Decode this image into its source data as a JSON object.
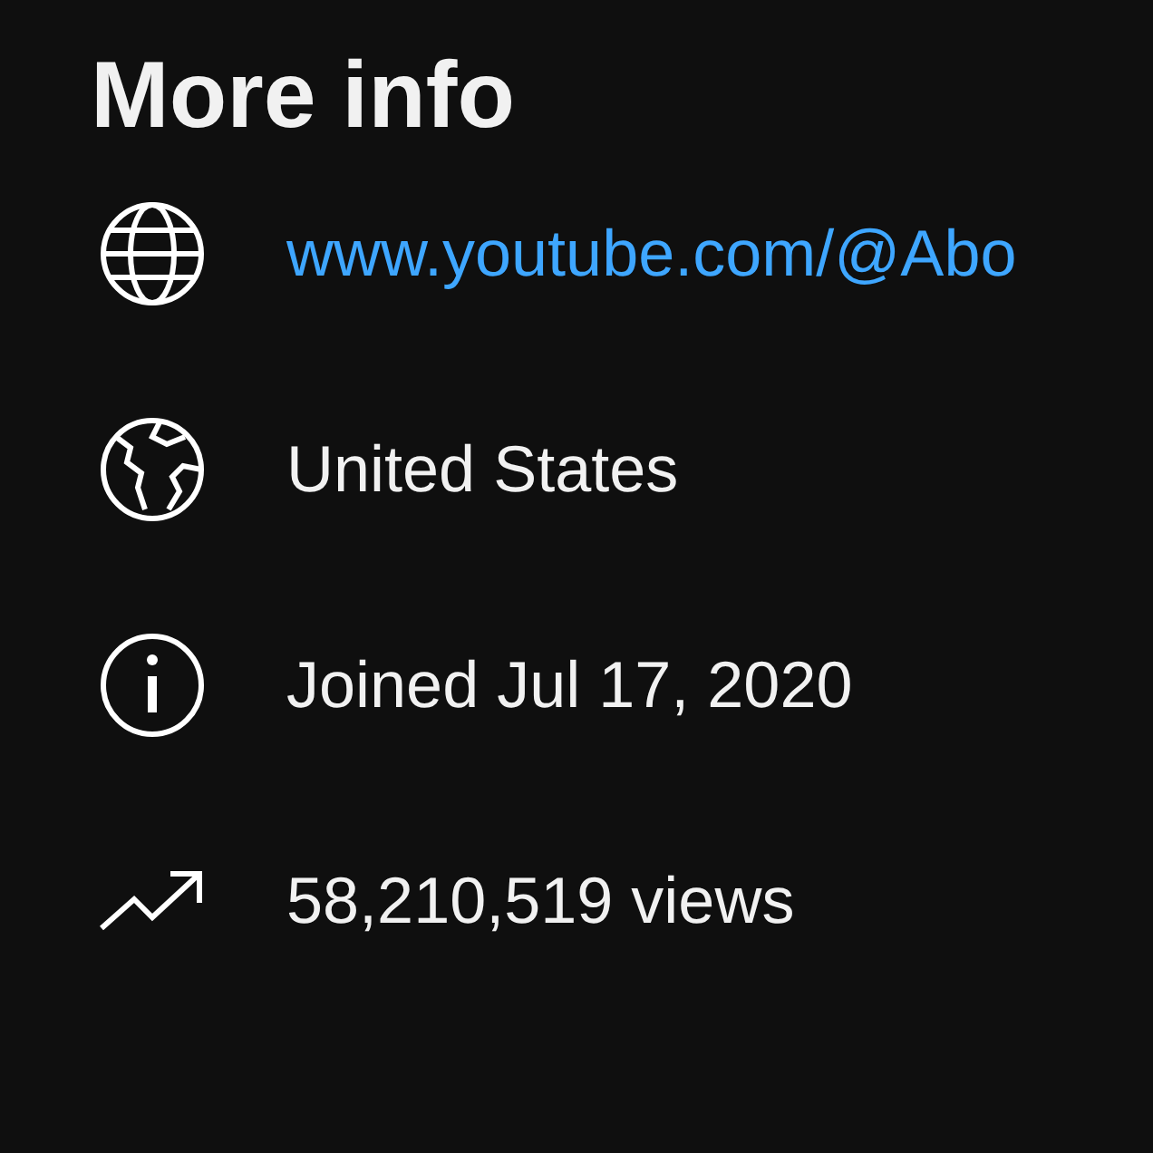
{
  "title": "More info",
  "items": [
    {
      "kind": "link",
      "text": "www.youtube.com/@Abo"
    },
    {
      "kind": "country",
      "text": "United States"
    },
    {
      "kind": "joined",
      "text": "Joined Jul 17, 2020"
    },
    {
      "kind": "views",
      "text": "58,210,519 views"
    }
  ]
}
